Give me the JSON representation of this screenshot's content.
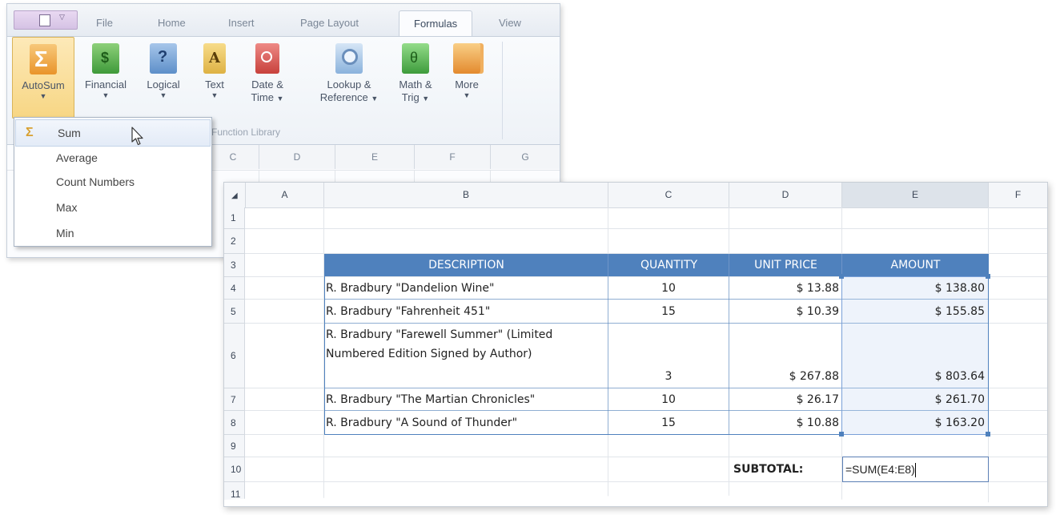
{
  "ribbon": {
    "tabs": [
      "File",
      "Home",
      "Insert",
      "Page Layout",
      "Formulas",
      "View"
    ],
    "active_tab": "Formulas",
    "buttons": [
      {
        "line1": "AutoSum",
        "line2": "",
        "icon": "sigma-icon",
        "color": "#f0a840"
      },
      {
        "line1": "Financial",
        "line2": "",
        "icon": "dollar-book-icon",
        "color": "#4caf50"
      },
      {
        "line1": "Logical",
        "line2": "",
        "icon": "question-book-icon",
        "color": "#6e9bd0"
      },
      {
        "line1": "Text",
        "line2": "",
        "icon": "text-book-icon",
        "color": "#e8c060"
      },
      {
        "line1": "Date &",
        "line2": "Time",
        "icon": "clock-book-icon",
        "color": "#d9534f"
      },
      {
        "line1": "Lookup &",
        "line2": "Reference",
        "icon": "magnifier-book-icon",
        "color": "#8fb8e0"
      },
      {
        "line1": "Math &",
        "line2": "Trig",
        "icon": "theta-book-icon",
        "color": "#5cb85c"
      },
      {
        "line1": "More",
        "line2": "",
        "icon": "books-icon",
        "color": "#f0a040"
      }
    ],
    "group_label": "Function Library",
    "bg_columns": [
      "C",
      "D",
      "E",
      "F",
      "G"
    ]
  },
  "autosum_menu": {
    "items": [
      "Sum",
      "Average",
      "Count Numbers",
      "Max",
      "Min"
    ],
    "highlighted": "Sum"
  },
  "sheet": {
    "columns": [
      "A",
      "B",
      "C",
      "D",
      "E",
      "F"
    ],
    "rows": [
      "1",
      "2",
      "3",
      "4",
      "5",
      "6",
      "7",
      "8",
      "9",
      "10",
      "11"
    ],
    "table_headers": [
      "DESCRIPTION",
      "QUANTITY",
      "UNIT PRICE",
      "AMOUNT"
    ],
    "table_rows": [
      {
        "description": "R. Bradbury \"Dandelion Wine\"",
        "quantity": "10",
        "unit_price": "$ 13.88",
        "amount": "$ 138.80"
      },
      {
        "description": "R. Bradbury \"Fahrenheit 451\"",
        "quantity": "15",
        "unit_price": "$ 10.39",
        "amount": "$ 155.85"
      },
      {
        "description": "R. Bradbury \"Farewell Summer\" (Limited Numbered Edition Signed by Author)",
        "quantity": "3",
        "unit_price": "$ 267.88",
        "amount": "$ 803.64"
      },
      {
        "description": "R. Bradbury \"The Martian Chronicles\"",
        "quantity": "10",
        "unit_price": "$ 26.17",
        "amount": "$ 261.70"
      },
      {
        "description": "R. Bradbury \"A Sound of Thunder\"",
        "quantity": "15",
        "unit_price": "$ 10.88",
        "amount": "$ 163.20"
      }
    ],
    "subtotal_label": "SUBTOTAL:",
    "formula": "=SUM(E4:E8)",
    "selected_column": "E",
    "accent_color": "#4f81bd"
  }
}
